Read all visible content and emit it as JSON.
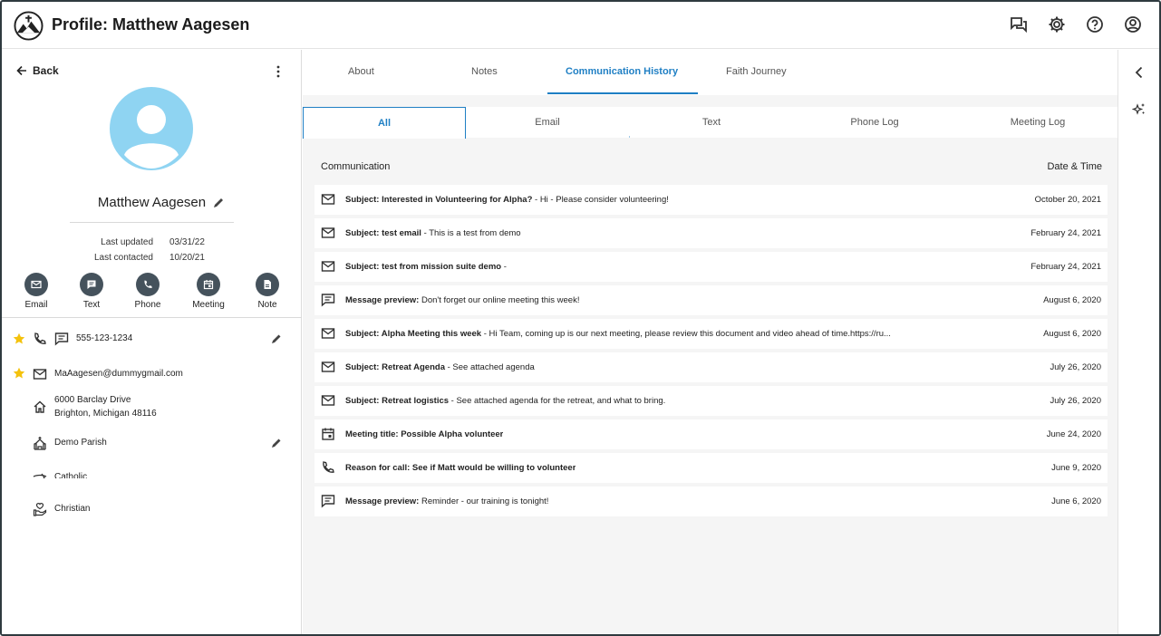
{
  "header": {
    "title": "Profile: Matthew Aagesen",
    "icons": [
      "chat-icon",
      "settings-icon",
      "help-icon",
      "account-icon"
    ]
  },
  "profile": {
    "back_label": "Back",
    "name": "Matthew Aagesen",
    "last_updated_label": "Last updated",
    "last_updated_value": "03/31/22",
    "last_contacted_label": "Last contacted",
    "last_contacted_value": "10/20/21",
    "actions": [
      {
        "label": "Email",
        "icon": "email-icon"
      },
      {
        "label": "Text",
        "icon": "text-icon"
      },
      {
        "label": "Phone",
        "icon": "phone-icon"
      },
      {
        "label": "Meeting",
        "icon": "calendar-icon"
      },
      {
        "label": "Note",
        "icon": "note-icon"
      }
    ],
    "phone": "555-123-1234",
    "email": "MaAagesen@dummygmail.com",
    "address_line1": "6000 Barclay Drive",
    "address_line2": "Brighton, Michigan 48116",
    "parish": "Demo Parish",
    "denomination": "Catholic",
    "faith": "Christian",
    "accent_color": "#8fd4f2"
  },
  "tabs": [
    "About",
    "Notes",
    "Communication History",
    "Faith Journey"
  ],
  "active_tab": "Communication History",
  "subtabs": [
    "All",
    "Email",
    "Text",
    "Phone Log",
    "Meeting Log"
  ],
  "active_subtab": "All",
  "list": {
    "col_left": "Communication",
    "col_right": "Date & Time",
    "rows": [
      {
        "icon": "email-icon",
        "bold": "Subject: Interested in Volunteering for Alpha?",
        "rest": " - Hi - Please consider volunteering!",
        "date": "October 20, 2021"
      },
      {
        "icon": "email-icon",
        "bold": "Subject: test email",
        "rest": " - This is a test from demo",
        "date": "February 24, 2021"
      },
      {
        "icon": "email-icon",
        "bold": "Subject: test from mission suite demo",
        "rest": " -",
        "date": "February 24, 2021"
      },
      {
        "icon": "message-icon",
        "bold": "Message preview:",
        "rest": " Don't forget our online meeting this week!",
        "date": "August 6, 2020"
      },
      {
        "icon": "email-icon",
        "bold": "Subject: Alpha Meeting this week",
        "rest": " - Hi Team, coming up is our next meeting, please review this document and video ahead of time.https://ru...",
        "date": "August 6, 2020"
      },
      {
        "icon": "email-icon",
        "bold": "Subject: Retreat Agenda",
        "rest": " - See attached agenda",
        "date": "July 26, 2020"
      },
      {
        "icon": "email-icon",
        "bold": "Subject: Retreat logistics",
        "rest": " - See attached agenda for the retreat, and what to bring.",
        "date": "July 26, 2020"
      },
      {
        "icon": "calendar-icon",
        "bold": "Meeting title: Possible Alpha volunteer",
        "rest": "",
        "date": "June 24, 2020"
      },
      {
        "icon": "phone-icon",
        "bold": "Reason for call: See if Matt would be willing to volunteer",
        "rest": "",
        "date": "June 9, 2020"
      },
      {
        "icon": "message-icon",
        "bold": "Message preview:",
        "rest": " Reminder - our training is tonight!",
        "date": "June 6, 2020"
      }
    ]
  },
  "colors": {
    "accent": "#1f7fc4",
    "star": "#f4c20d",
    "action_circle": "#45525c"
  }
}
